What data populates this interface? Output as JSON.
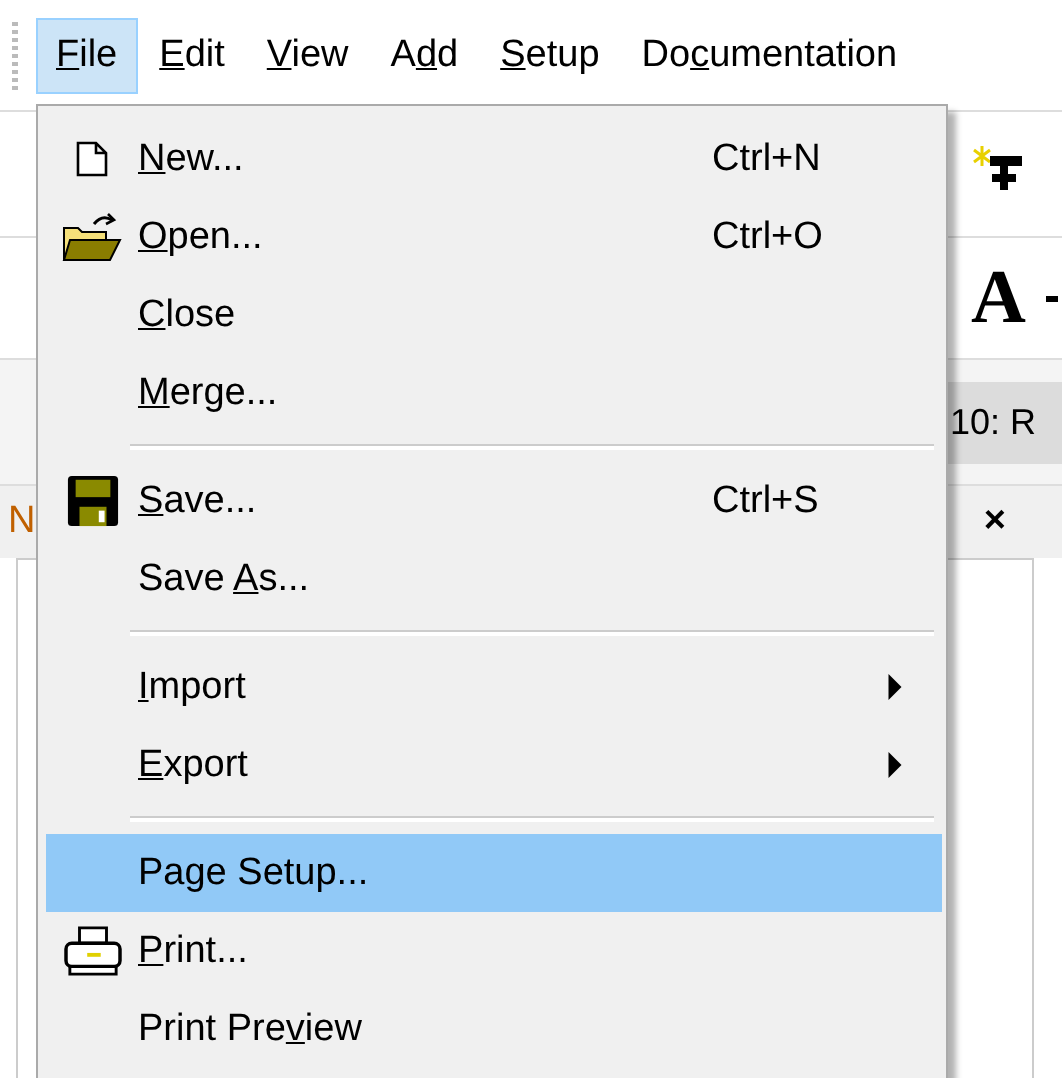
{
  "menubar": [
    {
      "key": "F",
      "post": "ile",
      "selected": true
    },
    {
      "key": "E",
      "post": "dit",
      "selected": false
    },
    {
      "key": "V",
      "post": "iew",
      "selected": false
    },
    {
      "pre": "A",
      "key": "d",
      "post": "d",
      "selected": false
    },
    {
      "key": "S",
      "post": "etup",
      "selected": false
    },
    {
      "pre": "Do",
      "key": "c",
      "post": "umentation",
      "selected": false
    }
  ],
  "background": {
    "toolbar_letter": "A",
    "tab_label": "10: R",
    "panel_title": "N",
    "panel_close": "×"
  },
  "file_menu": [
    {
      "kind": "item",
      "key": "N",
      "post": "ew...",
      "shortcut": "Ctrl+N",
      "selected": false
    },
    {
      "kind": "item",
      "key": "O",
      "post": "pen...",
      "shortcut": "Ctrl+O",
      "selected": false
    },
    {
      "kind": "item",
      "key": "C",
      "post": "lose",
      "selected": false
    },
    {
      "kind": "item",
      "key": "M",
      "post": "erge...",
      "selected": false
    },
    {
      "kind": "separator"
    },
    {
      "kind": "item",
      "key": "S",
      "post": "ave...",
      "shortcut": "Ctrl+S",
      "selected": false
    },
    {
      "kind": "item",
      "pre": "Save ",
      "key": "A",
      "post": "s...",
      "selected": false
    },
    {
      "kind": "separator"
    },
    {
      "kind": "submenu",
      "key": "I",
      "post": "mport",
      "selected": false
    },
    {
      "kind": "submenu",
      "key": "E",
      "post": "xport",
      "selected": false
    },
    {
      "kind": "separator"
    },
    {
      "kind": "item",
      "pre": "Page Setup...",
      "selected": true
    },
    {
      "kind": "item",
      "key": "P",
      "post": "rint...",
      "selected": false
    },
    {
      "kind": "item",
      "pre": "Print Pre",
      "key": "v",
      "post": "iew",
      "selected": false
    }
  ]
}
